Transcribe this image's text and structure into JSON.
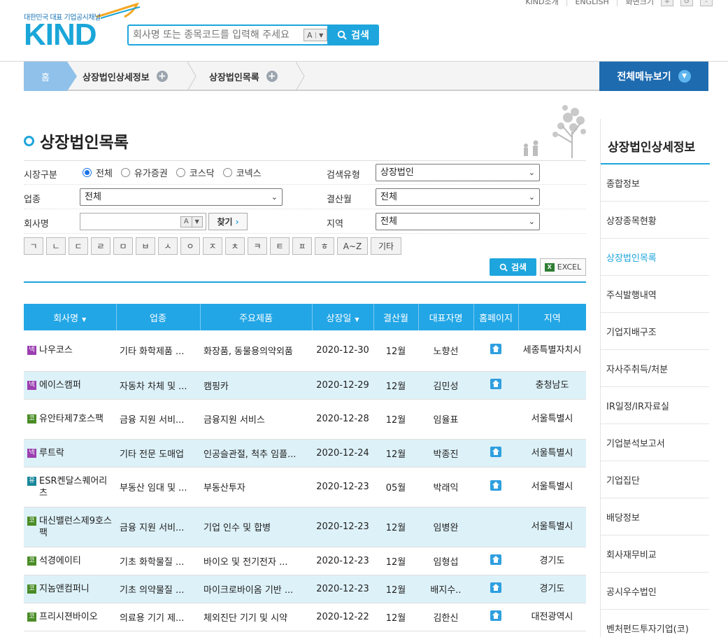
{
  "util": {
    "about": "KIND소개",
    "english": "ENGLISH",
    "zoom": "화면크기",
    "zoom_in": "+",
    "zoom_reset": "↺",
    "zoom_out": "-"
  },
  "logo": {
    "tagline": "대한민국 대표 기업공시채널",
    "word": "KIND"
  },
  "search": {
    "placeholder": "회사명 또는 종목코드를 입력해 주세요",
    "kbd_letter": "A",
    "kbd_arrow": "▼",
    "button": "검색"
  },
  "breadcrumb": {
    "home": "홈",
    "level1": "상장법인상세정보",
    "level2": "상장법인목록",
    "menu_all": "전체메뉴보기"
  },
  "page": {
    "title": "상장법인목록"
  },
  "filters": {
    "market_label": "시장구분",
    "market_options": [
      "전체",
      "유가증권",
      "코스닥",
      "코넥스"
    ],
    "market_selected": "전체",
    "search_type_label": "검색유형",
    "search_type_value": "상장법인",
    "industry_label": "업종",
    "industry_value": "전체",
    "fiscal_label": "결산월",
    "fiscal_value": "전체",
    "company_label": "회사명",
    "company_value": "",
    "find_button": "찾기",
    "region_label": "지역",
    "region_value": "전체",
    "consonants": [
      "ㄱ",
      "ㄴ",
      "ㄷ",
      "ㄹ",
      "ㅁ",
      "ㅂ",
      "ㅅ",
      "ㅇ",
      "ㅈ",
      "ㅊ",
      "ㅋ",
      "ㅌ",
      "ㅍ",
      "ㅎ",
      "A~Z",
      "기타"
    ],
    "search_button": "검색",
    "excel_button": "EXCEL"
  },
  "table": {
    "headers": [
      "회사명",
      "업종",
      "주요제품",
      "상장일",
      "결산월",
      "대표자명",
      "홈페이지",
      "지역"
    ],
    "rows": [
      {
        "market": "넥",
        "company": "나우코스",
        "industry": "기타 화학제품 ...",
        "product": "화장품, 동물용의약외품",
        "listed": "2020-12-30",
        "fiscal": "12월",
        "ceo": "노향선",
        "homepage": true,
        "region": "세종특별자치시"
      },
      {
        "market": "넥",
        "company": "에이스캠퍼",
        "industry": "자동차 차체 및 ...",
        "product": "캠핑카",
        "listed": "2020-12-29",
        "fiscal": "12월",
        "ceo": "김민성",
        "homepage": true,
        "region": "충청남도"
      },
      {
        "market": "코",
        "company": "유안타제7호스팩",
        "industry": "금융 지원 서비...",
        "product": "금융지원 서비스",
        "listed": "2020-12-28",
        "fiscal": "12월",
        "ceo": "임율표",
        "homepage": false,
        "region": "서울특별시"
      },
      {
        "market": "넥",
        "company": "루트락",
        "industry": "기타 전문 도매업",
        "product": "인공슬관절, 척추 임플...",
        "listed": "2020-12-24",
        "fiscal": "12월",
        "ceo": "박종진",
        "homepage": true,
        "region": "서울특별시"
      },
      {
        "market": "유",
        "company": "ESR켄달스퀘어리츠",
        "industry": "부동산 임대 및 ...",
        "product": "부동산투자",
        "listed": "2020-12-23",
        "fiscal": "05월",
        "ceo": "박래익",
        "homepage": true,
        "region": "서울특별시"
      },
      {
        "market": "코",
        "company": "대신밸런스제9호스팩",
        "industry": "금융 지원 서비...",
        "product": "기업 인수 및 합병",
        "listed": "2020-12-23",
        "fiscal": "12월",
        "ceo": "임병완",
        "homepage": false,
        "region": "서울특별시"
      },
      {
        "market": "코",
        "company": "석경에이티",
        "industry": "기초 화학물질 ...",
        "product": "바이오 및 전기전자 ...",
        "listed": "2020-12-23",
        "fiscal": "12월",
        "ceo": "임형섭",
        "homepage": true,
        "region": "경기도"
      },
      {
        "market": "코",
        "company": "지놈앤컴퍼니",
        "industry": "기초 의약물질 ...",
        "product": "마이크로바이옴 기반 ...",
        "listed": "2020-12-23",
        "fiscal": "12월",
        "ceo": "배지수..",
        "homepage": true,
        "region": "경기도"
      },
      {
        "market": "코",
        "company": "프리시젼바이오",
        "industry": "의료용 기기 제...",
        "product": "체외진단 기기 및 시약",
        "listed": "2020-12-22",
        "fiscal": "12월",
        "ceo": "김한신",
        "homepage": true,
        "region": "대전광역시"
      }
    ]
  },
  "sidebar": {
    "title": "상장법인상세정보",
    "items": [
      "종합정보",
      "상장종목현황",
      "상장법인목록",
      "주식발행내역",
      "기업지배구조",
      "자사주취득/처분",
      "IR일정/IR자료실",
      "기업분석보고서",
      "기업집단",
      "배당정보",
      "회사재무비교",
      "공시우수법인",
      "벤처펀드투자기업(코)"
    ],
    "active": "상장법인목록"
  },
  "colors": {
    "accent": "#1ea5dd",
    "header_row": "#22a6e6",
    "alt_row": "#ddf1f8",
    "menu_all": "#1e6bb0",
    "konex": "#9b3eb0",
    "kosdaq": "#4a8c26",
    "kospi": "#19879a"
  },
  "icons": {
    "search": "search-icon",
    "homepage": "home-icon",
    "excel": "excel-icon",
    "tree": "tree-illustration"
  }
}
